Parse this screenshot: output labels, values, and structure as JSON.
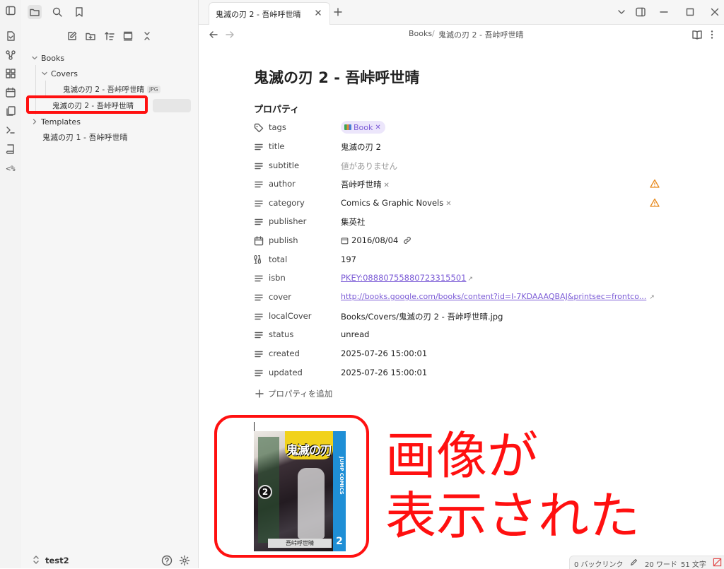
{
  "colors": {
    "accent": "#7b5bd6",
    "annotation": "#ff1010",
    "warning": "#e8891c",
    "cover_blue": "#1f8fd6"
  },
  "sidebar": {
    "tree": {
      "books": "Books",
      "covers": "Covers",
      "cover_file": "鬼滅の刃 2 - 吾峠呼世晴",
      "cover_badge": "JPG",
      "active_note": "鬼滅の刃 2 - 吾峠呼世晴",
      "templates": "Templates",
      "note1": "鬼滅の刃 1 - 吾峠呼世晴"
    },
    "vault_name": "test2"
  },
  "tab": {
    "title": "鬼滅の刃 2 - 吾峠呼世晴"
  },
  "breadcrumb": {
    "folder": "Books",
    "sep": "/",
    "file": "鬼滅の刃 2 - 吾峠呼世晴"
  },
  "note": {
    "title": "鬼滅の刃 2 - 吾峠呼世晴",
    "properties_heading": "プロパティ",
    "add_property": "プロパティを追加"
  },
  "properties": {
    "tags": {
      "name": "tags",
      "value": "Book",
      "icon": "tag-icon"
    },
    "title": {
      "name": "title",
      "value": "鬼滅の刃 2"
    },
    "subtitle": {
      "name": "subtitle",
      "value": "値がありません"
    },
    "author": {
      "name": "author",
      "value": "吾峠呼世晴"
    },
    "category": {
      "name": "category",
      "value": "Comics & Graphic Novels"
    },
    "publisher": {
      "name": "publisher",
      "value": "集英社"
    },
    "publish": {
      "name": "publish",
      "value": "2016/08/04"
    },
    "total": {
      "name": "total",
      "value": "197"
    },
    "isbn": {
      "name": "isbn",
      "value": "PKEY:08880755880723315501"
    },
    "cover": {
      "name": "cover",
      "value": "http://books.google.com/books/content?id=I-7KDAAAQBAJ&printsec=frontco..."
    },
    "localCover": {
      "name": "localCover",
      "value": "Books/Covers/鬼滅の刃 2 - 吾峠呼世晴.jpg"
    },
    "status": {
      "name": "status",
      "value": "unread"
    },
    "created": {
      "name": "created",
      "value": "2025-07-26 15:00:01"
    },
    "updated": {
      "name": "updated",
      "value": "2025-07-26 15:00:01"
    }
  },
  "cover_image": {
    "title_text": "鬼滅の刃",
    "volume": "2",
    "series": "JUMP COMICS",
    "author": "吾峠呼世晴"
  },
  "annotation": {
    "line1": "画像が",
    "line2": "表示された"
  },
  "statusbar": {
    "backlinks": "0 バックリンク",
    "words": "20 ワード",
    "chars": "51 文字"
  }
}
